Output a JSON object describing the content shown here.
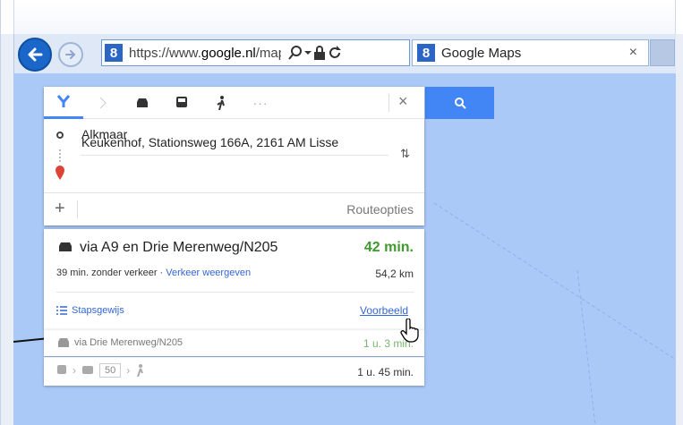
{
  "browser": {
    "url_prefix": "https://www.",
    "url_domain": "google.nl",
    "url_rest": "/maps",
    "tab_title": "Google Maps",
    "tab_close": "×"
  },
  "directions": {
    "origin": "Alkmaar",
    "destination": "Keukenhof, Stationsweg 166A, 2161 AM Lisse",
    "more_modes": "···",
    "close": "×",
    "add": "+",
    "route_options": "Routeopties",
    "swap": "⇅"
  },
  "routes": {
    "primary": {
      "via": "via A9 en Drie Merenweg/N205",
      "time": "42 min.",
      "traffic_note": "39 min. zonder verkeer · ",
      "traffic_link": "Verkeer weergeven",
      "distance": "54,2 km",
      "steps": "Stapsgewijs",
      "preview": "Voorbeeld"
    },
    "alternative": {
      "via": "via Drie Merenweg/N205",
      "time": "1 u. 3 min."
    },
    "transit": {
      "line": "50",
      "time": "1 u. 45 min."
    }
  },
  "colors": {
    "accent": "#4285f4",
    "time_green": "#3e9a2c",
    "map_water": "#abc9f7"
  }
}
